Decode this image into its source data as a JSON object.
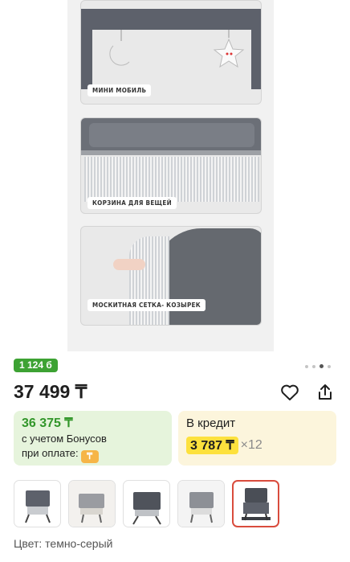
{
  "hero": {
    "panels": [
      {
        "label": "МИНИ МОБИЛЬ"
      },
      {
        "label": "КОРЗИНА ДЛЯ ВЕЩЕЙ"
      },
      {
        "label": "МОСКИТНАЯ СЕТКА- КОЗЫРЕК"
      }
    ],
    "dots": {
      "count": 4,
      "active_index": 2
    }
  },
  "bonus_badge": "1 124 б",
  "price": "37 499 ₸",
  "actions": {
    "favorite_icon": "heart-icon",
    "share_icon": "share-icon"
  },
  "bonus_card": {
    "price": "36 375 ₸",
    "line1": "с учетом Бонусов",
    "line2": "при оплате:",
    "coin_icon": "₸"
  },
  "credit_card": {
    "title": "В кредит",
    "amount": "3 787 ₸",
    "multiplier": "×12"
  },
  "thumbnails": {
    "count": 5,
    "selected_index": 4
  },
  "color": "Цвет: темно-серый",
  "colors": {
    "badge_green": "#3da233",
    "bonus_green": "#32962a",
    "credit_yellow": "#fde13d",
    "selected_border": "#d94c3d"
  }
}
